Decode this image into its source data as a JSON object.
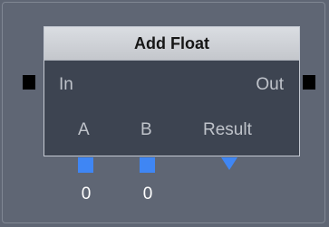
{
  "node": {
    "title": "Add Float",
    "exec_in_label": "In",
    "exec_out_label": "Out",
    "inputs": [
      {
        "label": "A",
        "value": "0"
      },
      {
        "label": "B",
        "value": "0"
      }
    ],
    "output": {
      "label": "Result"
    }
  },
  "colors": {
    "canvas": "#5f6674",
    "node_body": "#3d4451",
    "header": "#d2d5da",
    "pin_float": "#3f86f4",
    "pin_exec": "#000000"
  }
}
